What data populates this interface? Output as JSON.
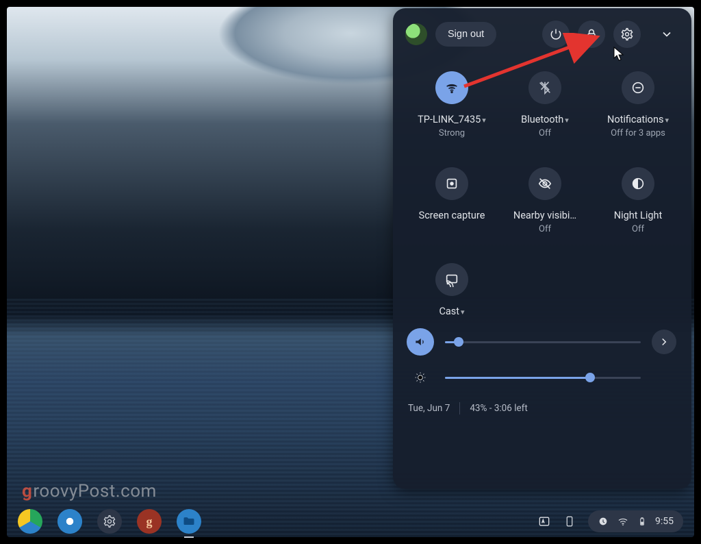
{
  "header": {
    "signout_label": "Sign out"
  },
  "tiles": {
    "wifi": {
      "label": "TP-LINK_7435",
      "sub": "Strong",
      "dropdown": true,
      "on": true
    },
    "bluetooth": {
      "label": "Bluetooth",
      "sub": "Off",
      "dropdown": true,
      "on": false
    },
    "notifications": {
      "label": "Notifications",
      "sub": "Off for 3 apps",
      "dropdown": true,
      "on": false
    },
    "capture": {
      "label": "Screen capture",
      "sub": "",
      "dropdown": false,
      "on": false
    },
    "nearby": {
      "label": "Nearby visibi…",
      "sub": "Off",
      "dropdown": false,
      "on": false
    },
    "nightlight": {
      "label": "Night Light",
      "sub": "Off",
      "dropdown": false,
      "on": false
    },
    "cast": {
      "label": "Cast",
      "sub": "",
      "dropdown": true,
      "on": false
    }
  },
  "sliders": {
    "volume_pct": 7,
    "brightness_pct": 74
  },
  "footer": {
    "date": "Tue, Jun 7",
    "battery": "43% - 3:06 left"
  },
  "shelf": {
    "clock": "9:55"
  },
  "watermark": {
    "rest": "roovyPost.com"
  }
}
